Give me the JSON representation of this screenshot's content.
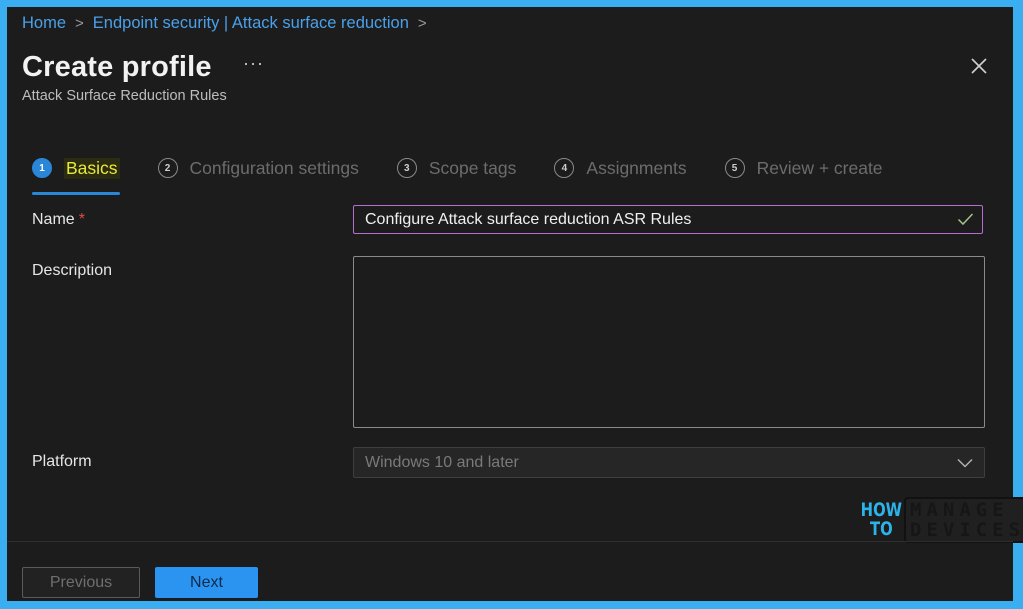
{
  "breadcrumb": {
    "items": [
      "Home",
      "Endpoint security | Attack surface reduction"
    ],
    "separator": ">"
  },
  "header": {
    "title": "Create profile",
    "more_label": "···",
    "subtitle": "Attack Surface Reduction Rules",
    "close_icon": "close-icon"
  },
  "steps": [
    {
      "number": "1",
      "label": "Basics",
      "active": true
    },
    {
      "number": "2",
      "label": "Configuration settings",
      "active": false
    },
    {
      "number": "3",
      "label": "Scope tags",
      "active": false
    },
    {
      "number": "4",
      "label": "Assignments",
      "active": false
    },
    {
      "number": "5",
      "label": "Review + create",
      "active": false
    }
  ],
  "form": {
    "name": {
      "label": "Name",
      "required_marker": "*",
      "value": "Configure Attack surface reduction ASR Rules",
      "valid": true
    },
    "description": {
      "label": "Description",
      "value": ""
    },
    "platform": {
      "label": "Platform",
      "value": "Windows 10 and later"
    }
  },
  "logo": {
    "line1": "HOW",
    "line2": "TO",
    "word1": "MANAGE",
    "word2": "DEVICES"
  },
  "footer": {
    "previous_label": "Previous",
    "next_label": "Next"
  },
  "colors": {
    "accent": "#2a87d8",
    "frame": "#3aaef0",
    "name_border": "#b46fd0",
    "highlight_text": "#e8e83a"
  }
}
